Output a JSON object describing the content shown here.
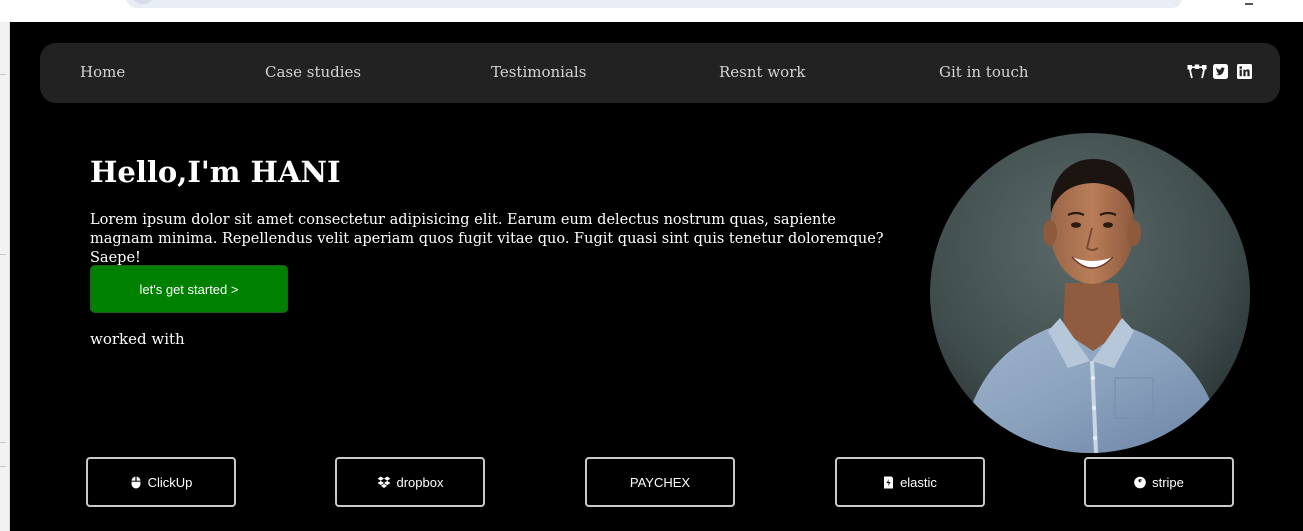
{
  "nav": {
    "links": [
      "Home",
      "Case studies",
      "Testimonials",
      "Resnt work",
      "Git in touch"
    ],
    "social_icons": [
      "bezier-curve-icon",
      "twitter-square-icon",
      "linkedin-icon"
    ]
  },
  "hero": {
    "title": "Hello,I'm HANI",
    "description": "Lorem ipsum dolor sit amet consectetur adipisicing elit. Earum eum delectus nostrum quas, sapiente magnam minima. Repellendus velit aperiam quos fugit vitae quo. Fugit quasi sint quis tenetur doloremque? Saepe!",
    "cta_label": "let's get started >",
    "worked_with_label": "worked with"
  },
  "brands": [
    {
      "label": "ClickUp",
      "icon": "mouse-icon"
    },
    {
      "label": "dropbox",
      "icon": "dropbox-icon"
    },
    {
      "label": "PAYCHEX",
      "icon": ""
    },
    {
      "label": "elastic",
      "icon": "elastic-icon"
    },
    {
      "label": "stripe",
      "icon": "stripe-icon"
    }
  ],
  "colors": {
    "page_background": "#000000",
    "navbar_background": "#222222",
    "nav_text": "#d4d4d4",
    "cta_background": "#008000",
    "text": "#ffffff",
    "brand_border": "#c9c9c9"
  }
}
